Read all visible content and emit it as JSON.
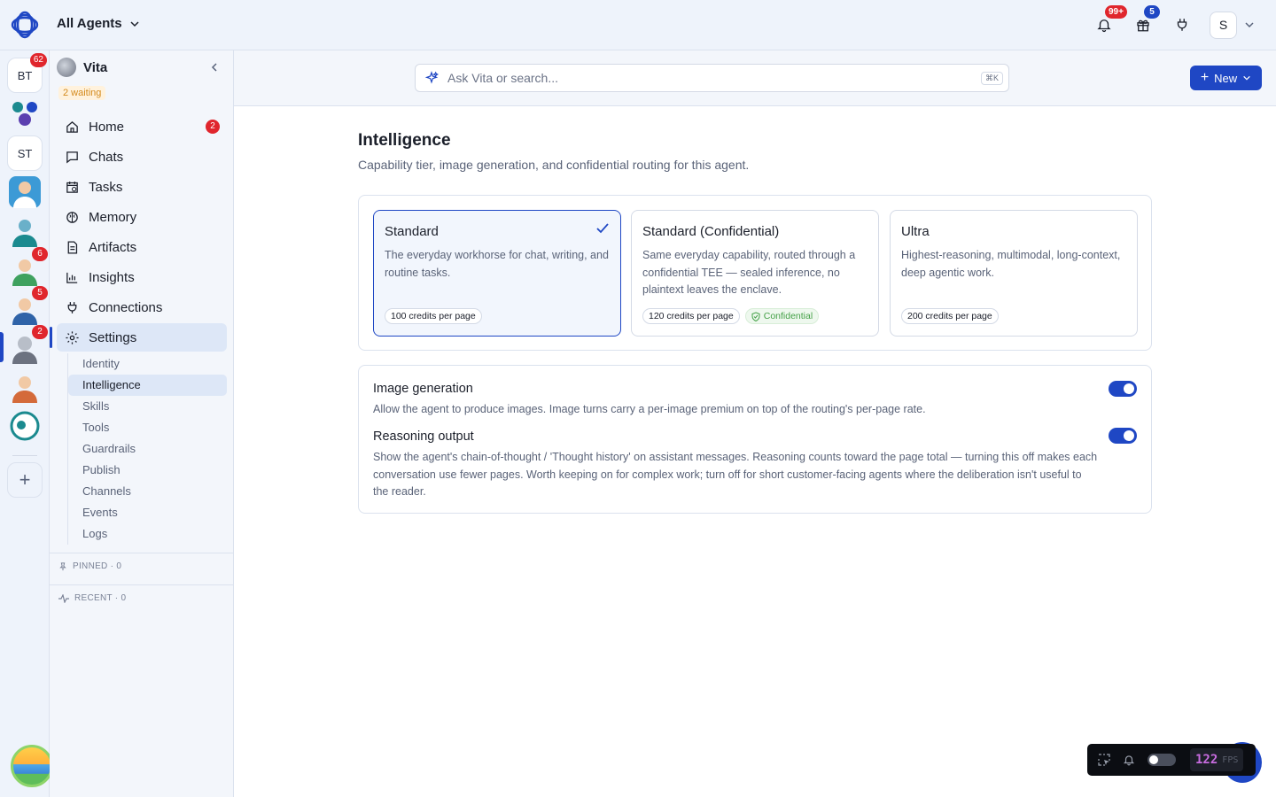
{
  "topbar": {
    "agent_selector": "All Agents",
    "notifications_badge": "99+",
    "gifts_badge": "5",
    "user_initial": "S"
  },
  "rail": {
    "items": [
      {
        "label": "BT",
        "badge": "62"
      },
      {
        "label": "",
        "badge": ""
      },
      {
        "label": "ST",
        "badge": ""
      },
      {
        "label": "",
        "badge": ""
      },
      {
        "label": "",
        "badge": ""
      },
      {
        "label": "",
        "badge": "6"
      },
      {
        "label": "",
        "badge": "5"
      },
      {
        "label": "",
        "badge": "2"
      },
      {
        "label": "",
        "badge": ""
      },
      {
        "label": "",
        "badge": ""
      }
    ]
  },
  "sidebar": {
    "agent_name": "Vita",
    "waiting": "2 waiting",
    "nav": [
      {
        "label": "Home",
        "count": "2"
      },
      {
        "label": "Chats"
      },
      {
        "label": "Tasks"
      },
      {
        "label": "Memory"
      },
      {
        "label": "Artifacts"
      },
      {
        "label": "Insights"
      },
      {
        "label": "Connections"
      },
      {
        "label": "Settings"
      }
    ],
    "sub": [
      "Identity",
      "Intelligence",
      "Skills",
      "Tools",
      "Guardrails",
      "Publish",
      "Channels",
      "Events",
      "Logs"
    ],
    "pinned": "PINNED · 0",
    "recent": "RECENT · 0"
  },
  "search": {
    "placeholder": "Ask Vita or search...",
    "shortcut": "⌘K"
  },
  "new_button": "New",
  "page": {
    "title": "Intelligence",
    "subtitle": "Capability tier, image generation, and confidential routing for this agent."
  },
  "tiers": [
    {
      "name": "Standard",
      "desc": "The everyday workhorse for chat, writing, and routine tasks.",
      "credits": "100 credits per page",
      "selected": true
    },
    {
      "name": "Standard (Confidential)",
      "desc": "Same everyday capability, routed through a confidential TEE — sealed inference, no plaintext leaves the enclave.",
      "credits": "120 credits per page",
      "tag": "Confidential"
    },
    {
      "name": "Ultra",
      "desc": "Highest-reasoning, multimodal, long-context, deep agentic work.",
      "credits": "200 credits per page"
    }
  ],
  "options": {
    "image_generation": {
      "title": "Image generation",
      "desc": "Allow the agent to produce images. Image turns carry a per-image premium on top of the routing's per-page rate.",
      "enabled": true
    },
    "reasoning_output": {
      "title": "Reasoning output",
      "desc": "Show the agent's chain-of-thought / 'Thought history' on assistant messages. Reasoning counts toward the page total — turning this off makes each conversation use fewer pages. Worth keeping on for complex work; turn off for short customer-facing agents where the deliberation isn't useful to the reader.",
      "enabled": true
    }
  },
  "fps": {
    "value": "122",
    "unit": "FPS"
  },
  "colors": {
    "accent": "#1f47c4",
    "badge_red": "#e0262d",
    "confidential_green": "#45a148"
  }
}
